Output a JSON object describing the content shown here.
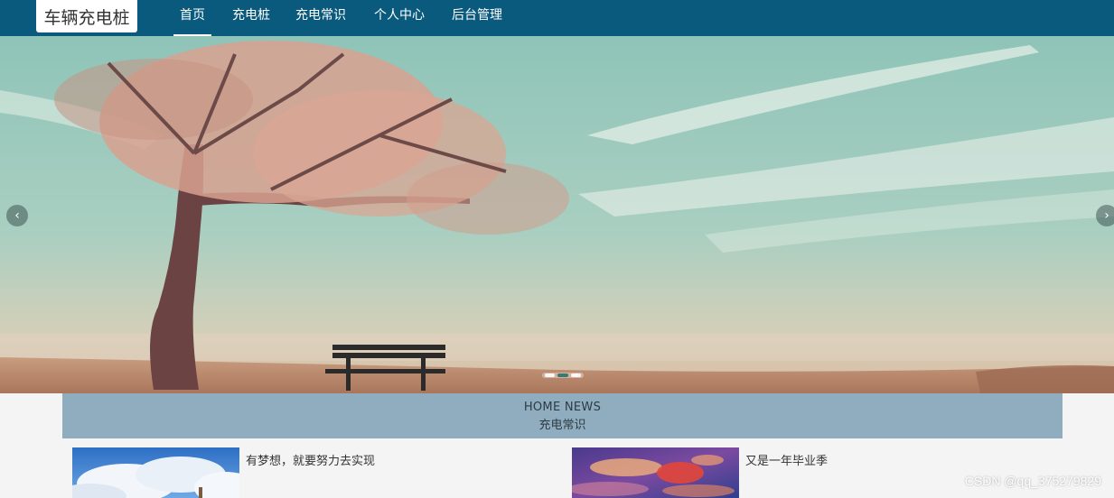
{
  "brand": {
    "name": "车辆充电桩"
  },
  "nav": {
    "items": [
      {
        "label": "首页",
        "active": true
      },
      {
        "label": "充电桩",
        "active": false
      },
      {
        "label": "充电常识",
        "active": false
      },
      {
        "label": "个人中心",
        "active": false
      },
      {
        "label": "后台管理",
        "active": false
      }
    ]
  },
  "carousel": {
    "prev_glyph": "‹",
    "next_glyph": "›",
    "slide_count": 3,
    "active_index": 1
  },
  "news_section": {
    "title_en": "HOME NEWS",
    "title_cn": "充电常识"
  },
  "news": [
    {
      "title": "有梦想，就要努力去实现"
    },
    {
      "title": "又是一年毕业季"
    }
  ],
  "watermark": "CSDN @qq_375279829",
  "colors": {
    "navbar": "#0a5a7e",
    "news_header": "#8fadbf",
    "page_bg": "#f4f4f4"
  }
}
